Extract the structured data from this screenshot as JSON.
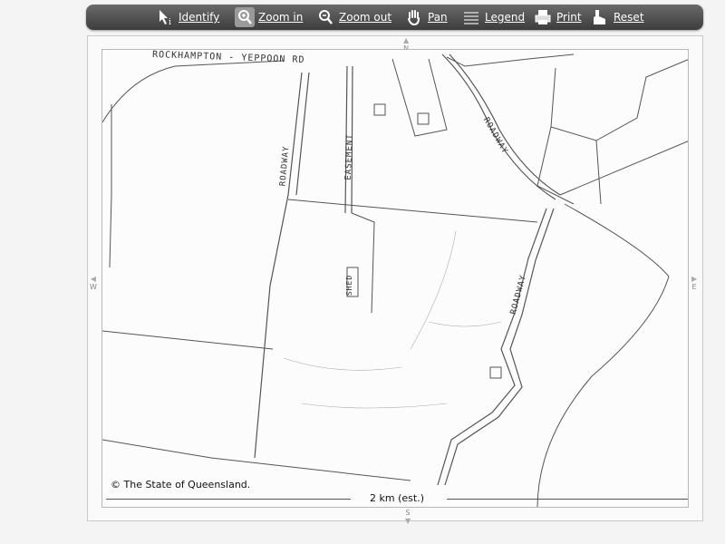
{
  "toolbar": {
    "identify": "Identify",
    "zoom_in": "Zoom in",
    "zoom_out": "Zoom out",
    "pan": "Pan",
    "legend": "Legend",
    "print": "Print",
    "reset": "Reset"
  },
  "map": {
    "road_label_top": "ROCKHAMPTON - YEPPOON RD",
    "roadway_label_1": "ROADWAY",
    "easement_label": "EASEMENT",
    "roadway_label_2": "ROADWAY",
    "roadway_label_3": "ROADWAY",
    "shed_label": "SHED",
    "copyright": "© The State of Queensland.",
    "scale": "2 km (est.)",
    "compass": {
      "n": "N",
      "s": "S",
      "e": "E",
      "w": "W"
    }
  },
  "colors": {
    "toolbar_bg": "#4a4a4a",
    "toolbar_text": "#ffffff"
  }
}
